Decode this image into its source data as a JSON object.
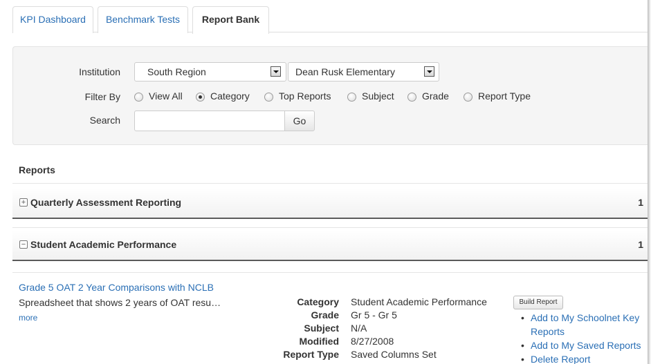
{
  "tabs": [
    {
      "label": "KPI Dashboard",
      "active": false
    },
    {
      "label": "Benchmark Tests",
      "active": false
    },
    {
      "label": "Report Bank",
      "active": true
    }
  ],
  "filters": {
    "institution_label": "Institution",
    "institution_select_1": "South Region",
    "institution_select_2": "Dean Rusk Elementary",
    "filter_by_label": "Filter By",
    "filter_options": [
      {
        "label": "View All",
        "checked": false
      },
      {
        "label": "Category",
        "checked": true
      },
      {
        "label": "Top Reports",
        "checked": false
      },
      {
        "label": "Subject",
        "checked": false
      },
      {
        "label": "Grade",
        "checked": false
      },
      {
        "label": "Report Type",
        "checked": false
      }
    ],
    "search_label": "Search",
    "search_value": "",
    "go_label": "Go"
  },
  "reports": {
    "title": "Reports",
    "categories": [
      {
        "toggle": "+",
        "title": "Quarterly Assessment Reporting",
        "count": "1"
      },
      {
        "toggle": "−",
        "title": "Student Academic Performance",
        "count": "1"
      }
    ],
    "item": {
      "title": "Grade 5 OAT 2 Year Comparisons with NCLB",
      "description": "Spreadsheet that shows 2 years of OAT resu…",
      "more": "more",
      "meta": [
        {
          "key": "Category",
          "value": "Student Academic Performance"
        },
        {
          "key": "Grade",
          "value": "Gr 5 - Gr 5"
        },
        {
          "key": "Subject",
          "value": "N/A"
        },
        {
          "key": "Modified",
          "value": "8/27/2008"
        },
        {
          "key": "Report Type",
          "value": "Saved Columns Set"
        }
      ],
      "build_label": "Build Report",
      "actions": [
        "Add to My Schoolnet Key Reports",
        "Add to My Saved Reports",
        "Delete Report"
      ]
    }
  }
}
